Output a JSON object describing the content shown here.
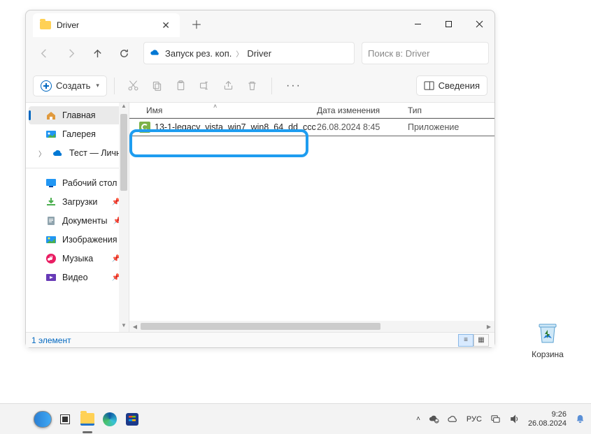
{
  "window": {
    "tab_title": "Driver",
    "breadcrumb": {
      "root": "Запуск рез. коп.",
      "current": "Driver"
    },
    "search_placeholder": "Поиск в: Driver",
    "create_label": "Создать",
    "details_label": "Сведения",
    "columns": {
      "name": "Имя",
      "modified": "Дата изменения",
      "type": "Тип"
    },
    "files": [
      {
        "name": "13-1-legacy_vista_win7_win8_64_dd_ccc",
        "modified": "26.08.2024 8:45",
        "type": "Приложение"
      }
    ],
    "status": "1 элемент"
  },
  "sidebar": {
    "home": "Главная",
    "gallery": "Галерея",
    "personal": "Тест — Личное",
    "desktop": "Рабочий стол",
    "downloads": "Загрузки",
    "documents": "Документы",
    "pictures": "Изображения",
    "music": "Музыка",
    "videos": "Видео"
  },
  "desktop": {
    "recycle": "Корзина"
  },
  "taskbar": {
    "lang": "РУС",
    "time": "9:26",
    "date": "26.08.2024"
  }
}
